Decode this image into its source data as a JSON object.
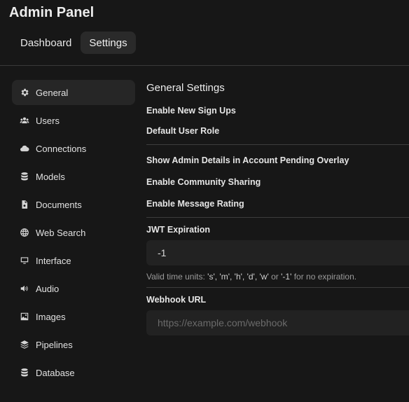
{
  "app": {
    "title": "Admin Panel"
  },
  "top_tabs": [
    {
      "label": "Dashboard",
      "active": false
    },
    {
      "label": "Settings",
      "active": true
    }
  ],
  "sidebar": {
    "items": [
      {
        "label": "General",
        "icon": "gear-icon",
        "active": true
      },
      {
        "label": "Users",
        "icon": "users-icon",
        "active": false
      },
      {
        "label": "Connections",
        "icon": "cloud-icon",
        "active": false
      },
      {
        "label": "Models",
        "icon": "database-icon",
        "active": false
      },
      {
        "label": "Documents",
        "icon": "document-icon",
        "active": false
      },
      {
        "label": "Web Search",
        "icon": "globe-icon",
        "active": false
      },
      {
        "label": "Interface",
        "icon": "monitor-icon",
        "active": false
      },
      {
        "label": "Audio",
        "icon": "speaker-icon",
        "active": false
      },
      {
        "label": "Images",
        "icon": "image-icon",
        "active": false
      },
      {
        "label": "Pipelines",
        "icon": "layers-icon",
        "active": false
      },
      {
        "label": "Database",
        "icon": "database-icon",
        "active": false
      }
    ]
  },
  "main": {
    "section_title": "General Settings",
    "enable_signups_label": "Enable New Sign Ups",
    "default_role_label": "Default User Role",
    "show_admin_details_label": "Show Admin Details in Account Pending Overlay",
    "enable_community_label": "Enable Community Sharing",
    "enable_rating_label": "Enable Message Rating",
    "jwt_label": "JWT Expiration",
    "jwt_value": "-1",
    "jwt_help_prefix": "Valid time units:",
    "jwt_help_units": "'s', 'm', 'h', 'd', 'w'",
    "jwt_help_or": "or",
    "jwt_help_never": "'-1'",
    "jwt_help_suffix": "for no expiration.",
    "webhook_label": "Webhook URL",
    "webhook_placeholder": "https://example.com/webhook"
  }
}
